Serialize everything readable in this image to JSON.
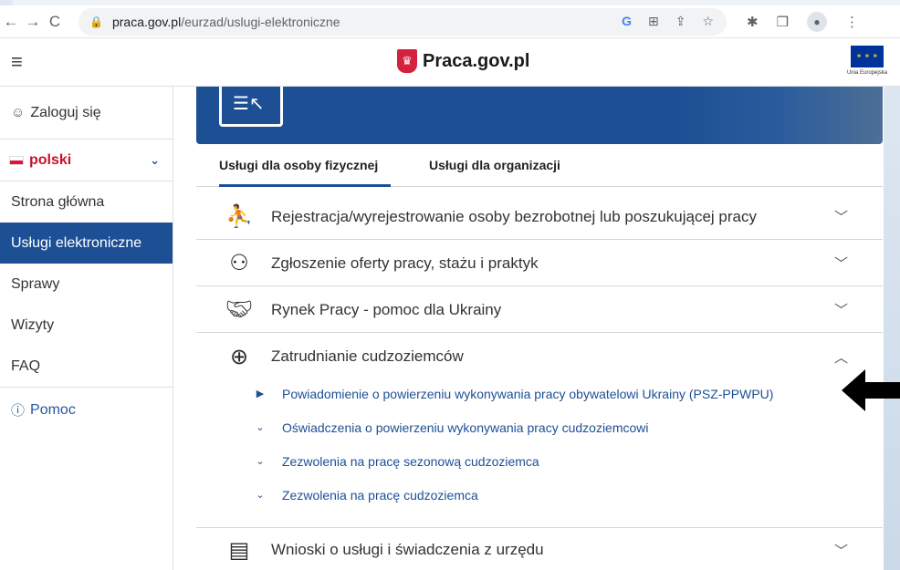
{
  "browser": {
    "back": "←",
    "forward": "→",
    "reload": "C",
    "url_host": "praca.gov.pl",
    "url_path": "/eurzad/uslugi-elektroniczne",
    "omni_icons": [
      "G",
      "⊞",
      "⇪",
      "☆"
    ],
    "extension_icons": [
      "✱",
      "❒",
      "●",
      "⋮"
    ]
  },
  "header": {
    "menu_glyph": "≡",
    "brand": "Praca.gov.pl",
    "eu_text": "Unia Europejska"
  },
  "sidebar": {
    "login": "Zaloguj się",
    "language": "polski",
    "items": [
      {
        "label": "Strona główna"
      },
      {
        "label": "Usługi elektroniczne"
      },
      {
        "label": "Sprawy"
      },
      {
        "label": "Wizyty"
      },
      {
        "label": "FAQ"
      }
    ],
    "help": "Pomoc"
  },
  "tabs": {
    "personal": "Usługi dla osoby fizycznej",
    "organization": "Usługi dla organizacji"
  },
  "accordion": [
    {
      "title": "Rejestracja/wyrejestrowanie osoby bezrobotnej lub poszukującej pracy",
      "icon": "registration-icon",
      "expanded": false
    },
    {
      "title": "Zgłoszenie oferty pracy, stażu i praktyk",
      "icon": "job-offer-icon",
      "expanded": false
    },
    {
      "title": "Rynek Pracy - pomoc dla Ukrainy",
      "icon": "handshake-icon",
      "expanded": false
    },
    {
      "title": "Zatrudnianie cudzoziemców",
      "icon": "passport-icon",
      "expanded": true
    },
    {
      "title": "Wnioski o usługi i świadczenia z urzędu",
      "icon": "documents-icon",
      "expanded": false
    }
  ],
  "sub_items": [
    {
      "label": "Powiadomienie o powierzeniu wykonywania pracy obywatelowi Ukrainy (PSZ-PPWPU)",
      "bullet": "▶"
    },
    {
      "label": "Oświadczenia o powierzeniu wykonywania pracy cudzoziemcowi",
      "bullet": "⌄"
    },
    {
      "label": "Zezwolenia na pracę sezonową cudzoziemca",
      "bullet": "⌄"
    },
    {
      "label": "Zezwolenia na pracę cudzoziemca",
      "bullet": "⌄"
    }
  ],
  "colors": {
    "primary": "#1d4f95",
    "flag_red": "#dc143c",
    "link": "#1d4f95"
  }
}
